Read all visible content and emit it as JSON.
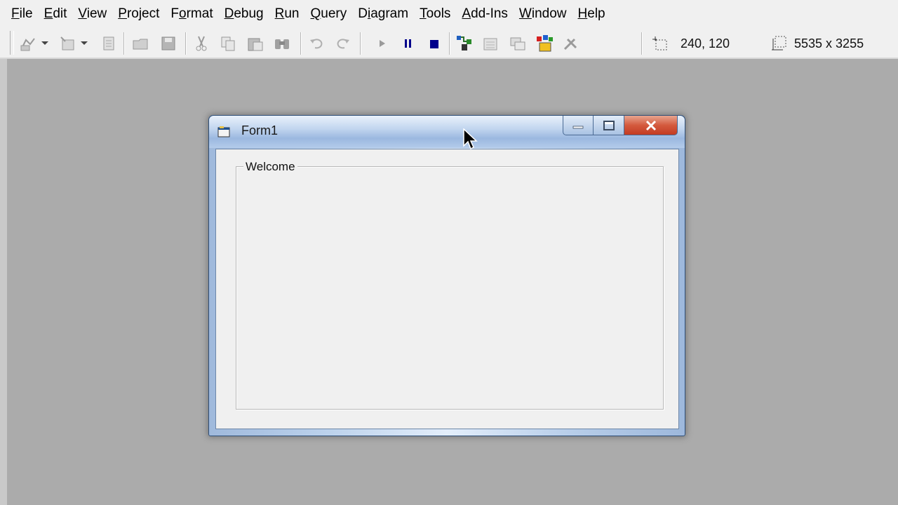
{
  "menubar": {
    "items": [
      {
        "underline": "F",
        "rest": "ile"
      },
      {
        "underline": "E",
        "rest": "dit"
      },
      {
        "underline": "V",
        "rest": "iew"
      },
      {
        "underline": "P",
        "rest": "roject"
      },
      {
        "underline": "",
        "pre": "F",
        "u2": "o",
        "rest": "rmat"
      },
      {
        "underline": "D",
        "rest": "ebug"
      },
      {
        "underline": "R",
        "rest": "un"
      },
      {
        "underline": "Q",
        "rest": "uery"
      },
      {
        "underline": "",
        "pre": "D",
        "u2": "i",
        "rest": "agram"
      },
      {
        "underline": "T",
        "rest": "ools"
      },
      {
        "underline": "A",
        "rest": "dd-Ins"
      },
      {
        "underline": "W",
        "rest": "indow"
      },
      {
        "underline": "H",
        "rest": "elp"
      }
    ]
  },
  "toolbar": {
    "position_readout": "240, 120",
    "size_readout": "5535 x 3255",
    "icons": [
      "add-project-icon",
      "add-form-icon",
      "menu-editor-icon",
      "open-project-icon",
      "save-project-icon",
      "cut-icon",
      "copy-icon",
      "paste-icon",
      "find-icon",
      "undo-icon",
      "redo-icon",
      "start-icon",
      "break-icon",
      "end-icon",
      "project-explorer-icon",
      "properties-window-icon",
      "form-layout-icon",
      "object-browser-icon",
      "toolbox-icon"
    ]
  },
  "form": {
    "title": "Form1",
    "frame_caption": "Welcome"
  },
  "colors": {
    "desktop": "#ababab",
    "close_button": "#c33b22",
    "stop_icon": "#00008b"
  }
}
